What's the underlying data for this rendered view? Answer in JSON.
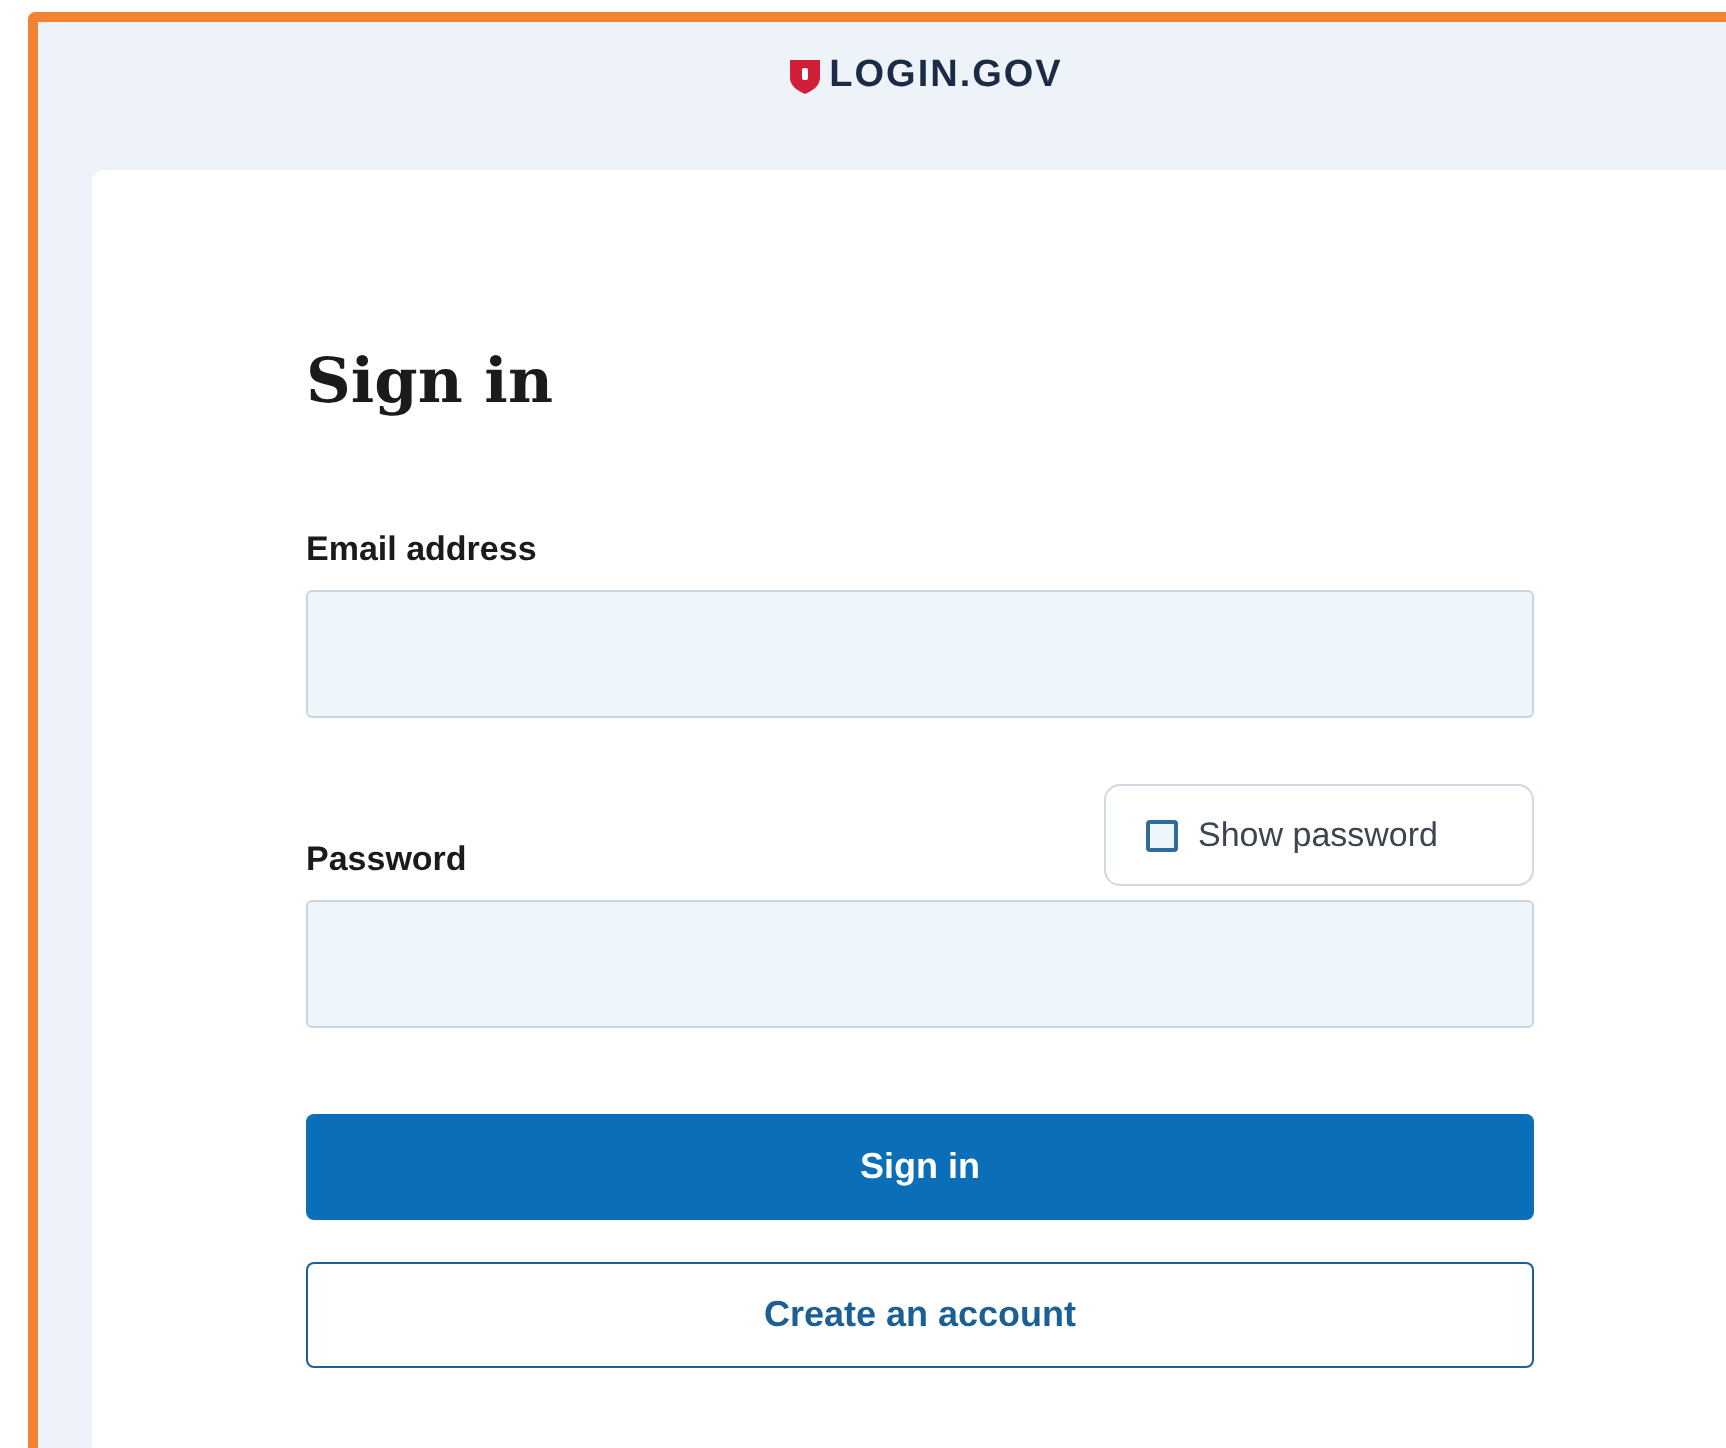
{
  "header": {
    "logo_text": "LOGIN.GOV"
  },
  "form": {
    "title": "Sign in",
    "fields": [
      {
        "label": "Email address",
        "kind": "email"
      },
      {
        "label": "Password",
        "kind": "password"
      }
    ],
    "show_password": {
      "label": "Show password",
      "checked": false
    },
    "buttons": [
      {
        "label": "Sign in",
        "kind": "primary"
      },
      {
        "label": "Create an account",
        "kind": "outline"
      }
    ]
  }
}
